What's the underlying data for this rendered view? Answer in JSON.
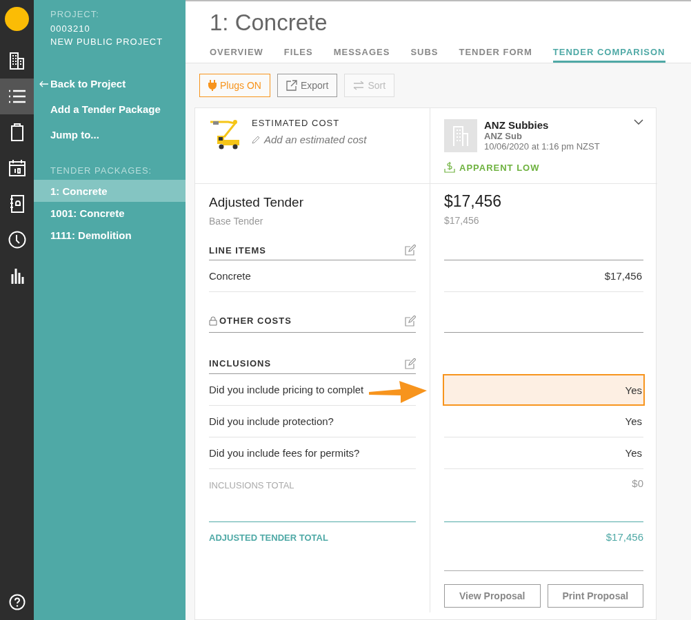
{
  "rail": {
    "items": [
      {
        "kind": "building",
        "selected": false
      },
      {
        "kind": "list",
        "selected": true
      },
      {
        "kind": "clipboard",
        "selected": false
      },
      {
        "kind": "calendar",
        "selected": false
      },
      {
        "kind": "contacts",
        "selected": false
      },
      {
        "kind": "clock",
        "selected": false
      },
      {
        "kind": "chart",
        "selected": false
      }
    ]
  },
  "sidebar": {
    "project_label": "PROJECT:",
    "project_number": "0003210",
    "project_name": "NEW PUBLIC PROJECT",
    "links": [
      "Back to Project",
      "Add a Tender Package",
      "Jump to..."
    ],
    "packages_label": "TENDER PACKAGES:",
    "packages": [
      {
        "label": "1: Concrete",
        "selected": true
      },
      {
        "label": "1001: Concrete",
        "selected": false
      },
      {
        "label": "1111: Demolition",
        "selected": false
      }
    ]
  },
  "page_title": "1: Concrete",
  "tabs": [
    {
      "label": "OVERVIEW",
      "selected": false
    },
    {
      "label": "FILES",
      "selected": false
    },
    {
      "label": "MESSAGES",
      "selected": false
    },
    {
      "label": "SUBS",
      "selected": false
    },
    {
      "label": "TENDER FORM",
      "selected": false
    },
    {
      "label": "TENDER COMPARISON",
      "selected": true
    }
  ],
  "toolbar": [
    {
      "kind": "plugs",
      "label": "Plugs ON",
      "disabled": false
    },
    {
      "kind": "export",
      "label": "Export",
      "disabled": false
    },
    {
      "kind": "sort",
      "label": "Sort",
      "disabled": true
    }
  ],
  "estimate": {
    "label": "ESTIMATED COST",
    "placeholder": "Add an estimated cost"
  },
  "bidder": {
    "name": "ANZ Subbies",
    "company": "ANZ Sub",
    "date": "10/06/2020 at 1:16 pm NZST",
    "badge": "APPARENT LOW"
  },
  "adjusted": {
    "label": "Adjusted Tender",
    "value": "$17,456",
    "base_label": "Base Tender",
    "base_value": "$17,456"
  },
  "line_items": {
    "title": "LINE ITEMS",
    "rows": [
      {
        "label": "Concrete",
        "value": "$17,456"
      }
    ]
  },
  "other_costs": {
    "title": "OTHER COSTS"
  },
  "inclusions": {
    "title": "INCLUSIONS",
    "rows": [
      {
        "label": "Did you include pricing to complet",
        "value": "Yes",
        "highlighted": true
      },
      {
        "label": "Did you include protection?",
        "value": "Yes",
        "highlighted": false
      },
      {
        "label": "Did you include fees for permits?",
        "value": "Yes",
        "highlighted": false
      }
    ],
    "total_label": "INCLUSIONS TOTAL",
    "total_value": "$0"
  },
  "total": {
    "label": "ADJUSTED TENDER TOTAL",
    "value": "$17,456"
  },
  "actions": [
    "View Proposal",
    "Print Proposal"
  ]
}
